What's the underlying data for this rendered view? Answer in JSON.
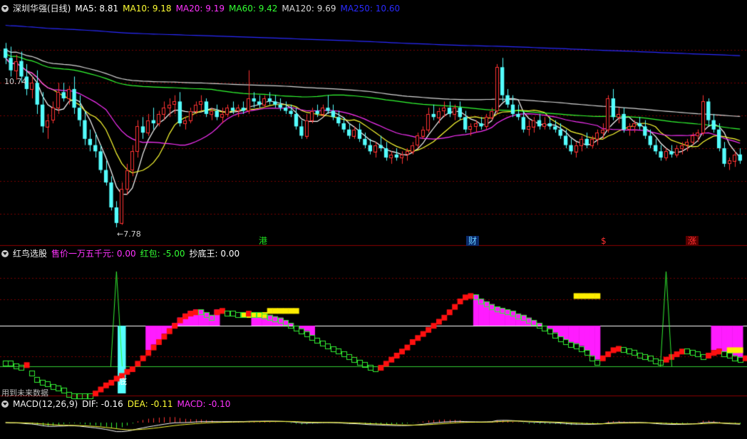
{
  "main_header": {
    "stock_name": "深圳华强(日线)",
    "indicators": [
      {
        "label": "MA5: 8.81",
        "color": "#ffffff"
      },
      {
        "label": "MA10: 9.18",
        "color": "#ffff33"
      },
      {
        "label": "MA20: 9.19",
        "color": "#ff33ff"
      },
      {
        "label": "MA60: 9.42",
        "color": "#33ff33"
      },
      {
        "label": "MA120: 9.69",
        "color": "#d8d8d8"
      },
      {
        "label": "MA250: 10.60",
        "color": "#2a2aff"
      }
    ]
  },
  "price_labels": {
    "high": "10.74",
    "low": "←7.78"
  },
  "event_flags": [
    {
      "text": "港",
      "color": "#20e020"
    },
    {
      "text": "财",
      "color": "#66ccff"
    },
    {
      "text": "$",
      "color": "#ff3030"
    },
    {
      "text": "涨",
      "color": "#ff3030"
    }
  ],
  "indicator_header": {
    "name": "红鸟选股",
    "items": [
      {
        "label": "售价一万五千元: 0.00",
        "color": "#ff33ff"
      },
      {
        "label": "红包: -5.00",
        "color": "#33ff33"
      },
      {
        "label": "抄底王: 0.00",
        "color": "#ffffff"
      }
    ]
  },
  "indicator_footer": "用到未来数据",
  "indicator_mark": "底",
  "macd_header": {
    "name": "MACD(12,26,9)",
    "items": [
      {
        "label": "DIF: -0.16",
        "color": "#ffffff"
      },
      {
        "label": "DEA: -0.11",
        "color": "#ffff33"
      },
      {
        "label": "MACD: -0.10",
        "color": "#ff33ff"
      }
    ]
  },
  "chart_data": {
    "type": "candlestick",
    "bars": 144,
    "price_ylim": [
      7.7,
      11.2
    ],
    "candles": [
      [
        10.65,
        10.74,
        10.4,
        10.5
      ],
      [
        10.5,
        10.68,
        10.2,
        10.3
      ],
      [
        10.3,
        10.55,
        10.15,
        10.45
      ],
      [
        10.45,
        10.6,
        10.1,
        10.2
      ],
      [
        10.2,
        10.4,
        9.9,
        10.0
      ],
      [
        10.0,
        10.2,
        9.85,
        10.1
      ],
      [
        10.1,
        10.3,
        9.6,
        9.75
      ],
      [
        9.75,
        9.95,
        9.3,
        9.4
      ],
      [
        9.4,
        9.6,
        9.2,
        9.5
      ],
      [
        9.5,
        9.8,
        9.45,
        9.7
      ],
      [
        9.7,
        10.1,
        9.6,
        9.95
      ],
      [
        9.95,
        10.1,
        9.8,
        9.85
      ],
      [
        9.85,
        10.05,
        9.75,
        10.0
      ],
      [
        10.0,
        10.2,
        9.6,
        9.7
      ],
      [
        9.7,
        9.9,
        9.4,
        9.5
      ],
      [
        9.5,
        9.65,
        9.1,
        9.2
      ],
      [
        9.2,
        9.35,
        9.0,
        9.1
      ],
      [
        9.1,
        9.3,
        8.9,
        9.0
      ],
      [
        9.0,
        9.1,
        8.65,
        8.7
      ],
      [
        8.7,
        8.85,
        8.45,
        8.5
      ],
      [
        8.5,
        8.6,
        8.05,
        8.1
      ],
      [
        8.1,
        8.2,
        7.78,
        7.85
      ],
      [
        7.85,
        8.5,
        7.82,
        8.4
      ],
      [
        8.4,
        8.8,
        8.3,
        8.7
      ],
      [
        8.7,
        9.1,
        8.6,
        9.0
      ],
      [
        9.0,
        9.5,
        8.9,
        9.4
      ],
      [
        9.4,
        9.55,
        9.2,
        9.3
      ],
      [
        9.3,
        9.6,
        9.25,
        9.5
      ],
      [
        9.5,
        9.7,
        9.35,
        9.45
      ],
      [
        9.45,
        9.65,
        9.4,
        9.6
      ],
      [
        9.6,
        9.8,
        9.5,
        9.7
      ],
      [
        9.7,
        9.85,
        9.55,
        9.75
      ],
      [
        9.75,
        9.9,
        9.6,
        9.8
      ],
      [
        9.8,
        9.95,
        9.4,
        9.45
      ],
      [
        9.45,
        9.55,
        9.35,
        9.5
      ],
      [
        9.5,
        9.7,
        9.45,
        9.65
      ],
      [
        9.65,
        9.8,
        9.6,
        9.75
      ],
      [
        9.75,
        9.9,
        9.65,
        9.8
      ],
      [
        9.8,
        9.85,
        9.55,
        9.6
      ],
      [
        9.6,
        9.7,
        9.5,
        9.65
      ],
      [
        9.65,
        9.75,
        9.5,
        9.55
      ],
      [
        9.55,
        9.7,
        9.45,
        9.6
      ],
      [
        9.6,
        9.75,
        9.55,
        9.7
      ],
      [
        9.7,
        9.8,
        9.6,
        9.65
      ],
      [
        9.65,
        9.75,
        9.55,
        9.7
      ],
      [
        9.7,
        9.8,
        9.6,
        9.65
      ],
      [
        9.65,
        10.3,
        9.6,
        9.85
      ],
      [
        9.85,
        9.95,
        9.7,
        9.8
      ],
      [
        9.8,
        9.9,
        9.7,
        9.75
      ],
      [
        9.75,
        9.9,
        9.7,
        9.85
      ],
      [
        9.85,
        9.95,
        9.75,
        9.8
      ],
      [
        9.8,
        9.9,
        9.7,
        9.75
      ],
      [
        9.75,
        9.85,
        9.65,
        9.7
      ],
      [
        9.7,
        9.8,
        9.6,
        9.65
      ],
      [
        9.65,
        9.75,
        9.55,
        9.6
      ],
      [
        9.6,
        9.7,
        9.35,
        9.4
      ],
      [
        9.4,
        9.5,
        9.2,
        9.25
      ],
      [
        9.25,
        9.6,
        9.2,
        9.5
      ],
      [
        9.5,
        9.7,
        9.45,
        9.65
      ],
      [
        9.65,
        9.75,
        9.55,
        9.6
      ],
      [
        9.6,
        9.75,
        9.55,
        9.7
      ],
      [
        9.7,
        9.9,
        9.6,
        9.65
      ],
      [
        9.65,
        9.75,
        9.5,
        9.55
      ],
      [
        9.55,
        9.65,
        9.4,
        9.45
      ],
      [
        9.45,
        9.55,
        9.3,
        9.35
      ],
      [
        9.35,
        9.45,
        9.2,
        9.25
      ],
      [
        9.25,
        9.4,
        9.2,
        9.35
      ],
      [
        9.35,
        9.45,
        9.15,
        9.2
      ],
      [
        9.2,
        9.3,
        9.05,
        9.1
      ],
      [
        9.1,
        9.2,
        8.95,
        9.0
      ],
      [
        9.0,
        9.15,
        8.9,
        9.1
      ],
      [
        9.1,
        9.25,
        9.0,
        9.05
      ],
      [
        9.05,
        9.15,
        8.85,
        8.9
      ],
      [
        8.9,
        9.0,
        8.8,
        8.95
      ],
      [
        8.95,
        9.05,
        8.85,
        8.9
      ],
      [
        8.9,
        9.0,
        8.8,
        8.95
      ],
      [
        8.95,
        9.05,
        8.85,
        9.0
      ],
      [
        9.0,
        9.15,
        8.95,
        9.1
      ],
      [
        9.1,
        9.3,
        9.05,
        9.25
      ],
      [
        9.25,
        9.4,
        9.2,
        9.35
      ],
      [
        9.35,
        9.7,
        9.3,
        9.6
      ],
      [
        9.6,
        9.75,
        9.5,
        9.55
      ],
      [
        9.55,
        9.7,
        9.45,
        9.65
      ],
      [
        9.65,
        9.8,
        9.55,
        9.7
      ],
      [
        9.7,
        9.8,
        9.55,
        9.6
      ],
      [
        9.6,
        9.75,
        9.5,
        9.7
      ],
      [
        9.7,
        9.8,
        9.5,
        9.55
      ],
      [
        9.55,
        9.65,
        9.3,
        9.35
      ],
      [
        9.35,
        9.45,
        9.25,
        9.4
      ],
      [
        9.4,
        9.5,
        9.3,
        9.45
      ],
      [
        9.45,
        9.55,
        9.35,
        9.4
      ],
      [
        9.4,
        9.6,
        9.35,
        9.55
      ],
      [
        9.55,
        9.7,
        9.5,
        9.65
      ],
      [
        9.65,
        10.4,
        9.6,
        10.35
      ],
      [
        10.35,
        10.5,
        9.8,
        9.9
      ],
      [
        9.9,
        10.0,
        9.7,
        9.75
      ],
      [
        9.75,
        9.9,
        9.55,
        9.6
      ],
      [
        9.6,
        9.75,
        9.5,
        9.55
      ],
      [
        9.55,
        9.65,
        9.3,
        9.35
      ],
      [
        9.35,
        9.5,
        9.25,
        9.4
      ],
      [
        9.4,
        9.55,
        9.3,
        9.5
      ],
      [
        9.5,
        9.6,
        9.35,
        9.4
      ],
      [
        9.4,
        9.55,
        9.35,
        9.45
      ],
      [
        9.45,
        9.55,
        9.35,
        9.4
      ],
      [
        9.4,
        9.5,
        9.3,
        9.35
      ],
      [
        9.35,
        9.45,
        9.2,
        9.25
      ],
      [
        9.25,
        9.35,
        9.05,
        9.1
      ],
      [
        9.1,
        9.2,
        8.95,
        9.0
      ],
      [
        9.0,
        9.15,
        8.9,
        9.1
      ],
      [
        9.1,
        9.25,
        9.0,
        9.2
      ],
      [
        9.2,
        9.3,
        9.05,
        9.1
      ],
      [
        9.1,
        9.25,
        9.05,
        9.2
      ],
      [
        9.2,
        9.35,
        9.1,
        9.3
      ],
      [
        9.3,
        9.45,
        9.2,
        9.35
      ],
      [
        9.35,
        9.9,
        9.3,
        9.85
      ],
      [
        9.85,
        10.0,
        9.5,
        9.55
      ],
      [
        9.55,
        9.7,
        9.45,
        9.6
      ],
      [
        9.6,
        9.7,
        9.3,
        9.35
      ],
      [
        9.35,
        9.45,
        9.25,
        9.4
      ],
      [
        9.4,
        9.5,
        9.3,
        9.45
      ],
      [
        9.45,
        9.55,
        9.35,
        9.4
      ],
      [
        9.4,
        9.5,
        9.2,
        9.25
      ],
      [
        9.25,
        9.35,
        9.05,
        9.1
      ],
      [
        9.1,
        9.2,
        8.95,
        9.0
      ],
      [
        9.0,
        9.1,
        8.85,
        8.9
      ],
      [
        8.9,
        9.05,
        8.85,
        9.0
      ],
      [
        9.0,
        9.1,
        8.9,
        8.95
      ],
      [
        8.95,
        9.1,
        8.9,
        9.05
      ],
      [
        9.05,
        9.15,
        8.95,
        9.1
      ],
      [
        9.1,
        9.2,
        9.0,
        9.15
      ],
      [
        9.15,
        9.3,
        9.1,
        9.25
      ],
      [
        9.25,
        9.35,
        9.15,
        9.3
      ],
      [
        9.3,
        9.9,
        9.25,
        9.8
      ],
      [
        9.8,
        9.85,
        9.4,
        9.5
      ],
      [
        9.5,
        9.6,
        9.3,
        9.35
      ],
      [
        9.35,
        9.45,
        9.0,
        9.05
      ],
      [
        9.05,
        9.15,
        8.75,
        8.8
      ],
      [
        8.8,
        8.9,
        8.7,
        8.85
      ],
      [
        8.85,
        9.0,
        8.75,
        8.95
      ],
      [
        8.95,
        9.05,
        8.8,
        8.85
      ]
    ],
    "moving_averages": [
      {
        "name": "MA5",
        "period": 5,
        "color": "#ffffff"
      },
      {
        "name": "MA10",
        "period": 10,
        "color": "#ffff33"
      },
      {
        "name": "MA20",
        "period": 20,
        "color": "#ff33ff"
      },
      {
        "name": "MA60",
        "start": 10.6,
        "end": 9.42,
        "color": "#33ff33"
      },
      {
        "name": "MA120",
        "start": 10.7,
        "end": 9.69,
        "color": "#d8d8d8"
      },
      {
        "name": "MA250",
        "start": 11.05,
        "end": 10.6,
        "color": "#2a2aff"
      }
    ],
    "hongniao": {
      "ylim": [
        -5,
        5
      ],
      "threshold": 0,
      "baseline": -3,
      "signal": [
        -2.6,
        -2.6,
        -2.8,
        -2.9,
        -2.7,
        -3.3,
        -3.8,
        -4.0,
        -4.1,
        -4.3,
        -4.4,
        -4.6,
        -4.9,
        -5.0,
        -5.0,
        -5.0,
        -5.0,
        -4.8,
        -4.5,
        -4.2,
        -4.0,
        -3.7,
        -3.5,
        -3.2,
        -3.0,
        -2.6,
        -2.2,
        -1.8,
        -1.4,
        -1.0,
        -0.6,
        -0.2,
        0.2,
        0.6,
        0.9,
        1.1,
        1.2,
        1.2,
        1.0,
        0.8,
        1.2,
        1.3,
        1.1,
        1.1,
        1.0,
        1.0,
        1.1,
        1.0,
        1.0,
        0.9,
        0.8,
        0.7,
        0.6,
        0.4,
        0.2,
        0.0,
        -0.2,
        -0.4,
        -0.7,
        -0.9,
        -1.1,
        -1.3,
        -1.5,
        -1.7,
        -1.9,
        -2.1,
        -2.3,
        -2.5,
        -2.7,
        -2.9,
        -3.0,
        -2.9,
        -2.6,
        -2.3,
        -2.0,
        -1.7,
        -1.4,
        -1.0,
        -0.7,
        -0.4,
        -0.1,
        0.2,
        0.5,
        0.8,
        1.2,
        1.6,
        2.0,
        2.3,
        2.4,
        2.3,
        2.0,
        1.8,
        1.6,
        1.4,
        1.3,
        1.2,
        1.1,
        0.9,
        0.8,
        0.6,
        0.4,
        0.2,
        0.0,
        -0.2,
        -0.5,
        -0.8,
        -1.0,
        -1.2,
        -1.3,
        -1.5,
        -1.8,
        -2.2,
        -2.5,
        -2.2,
        -1.9,
        -1.6,
        -1.5,
        -1.6,
        -1.7,
        -1.8,
        -2.0,
        -2.1,
        -2.2,
        -2.4,
        -2.5,
        -2.3,
        -2.1,
        -1.9,
        -1.7,
        -1.7,
        -1.8,
        -1.9,
        -2.1,
        -2.0,
        -1.8,
        -1.7,
        -1.9,
        -2.0,
        -2.2,
        -2.3,
        -2.2,
        -2.1,
        -2.3,
        -2.2
      ],
      "spikes": [
        {
          "bar": 21,
          "value": 4.0
        },
        {
          "bar": 125,
          "value": 4.0
        }
      ],
      "cyan_bar": {
        "bar": 22,
        "from": 0,
        "to": -5.0
      },
      "magenta_blocks": [
        {
          "from": 27,
          "to": 40,
          "value": -4.1
        },
        {
          "from": 47,
          "to": 58,
          "value": 0.6
        },
        {
          "from": 89,
          "to": 112,
          "value": -1.1
        },
        {
          "from": 134,
          "to": 139,
          "value": -1.0
        }
      ],
      "yellow_blocks": [
        {
          "from": 45,
          "to": 49,
          "value": 1.0
        },
        {
          "from": 50,
          "to": 55,
          "value": 1.3
        },
        {
          "from": 108,
          "to": 112,
          "value": 2.4
        },
        {
          "from": 137,
          "to": 139,
          "value": -1.6
        }
      ]
    },
    "macd": {
      "ylim": [
        -0.8,
        0.8
      ],
      "dif": -0.16,
      "dea": -0.11,
      "macd": -0.1
    }
  }
}
